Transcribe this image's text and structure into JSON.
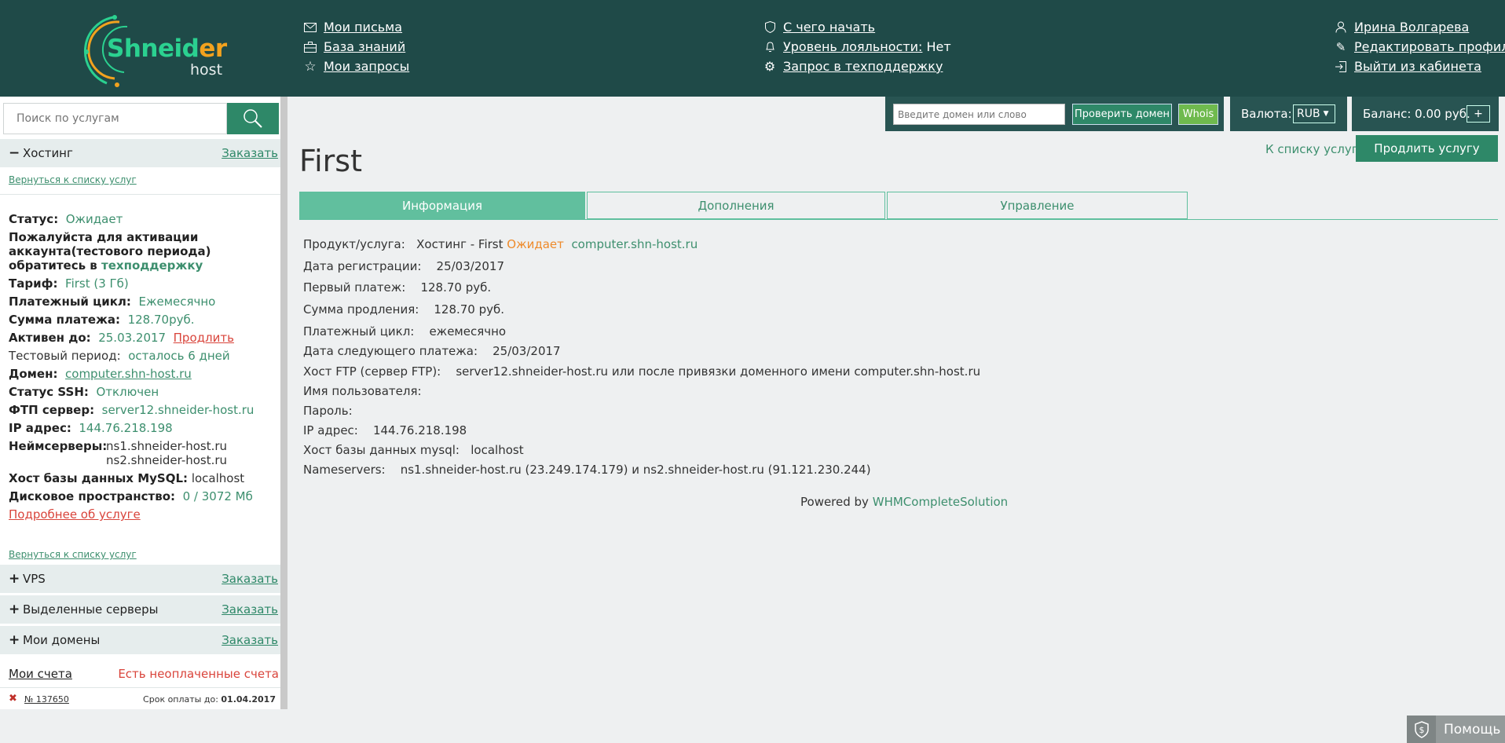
{
  "logo": {
    "word_part1": "Shneider",
    "word_part2": "host"
  },
  "header": {
    "nav_left": [
      {
        "label": "Мои письма",
        "icon": "mail-icon"
      },
      {
        "label": "База знаний",
        "icon": "briefcase-icon"
      },
      {
        "label": "Мои запросы",
        "icon": "star-icon"
      }
    ],
    "nav_mid": {
      "getting_started": "С чего начать",
      "loyalty_label": "Уровень лояльности:",
      "loyalty_value": "Нет",
      "support_request": "Запрос в техподдержку"
    },
    "user": {
      "name": "Ирина Волгарева",
      "edit_profile": "Редактировать профиль",
      "logout": "Выйти из кабинета"
    }
  },
  "sidebar": {
    "search_placeholder": "Поиск по услугам",
    "hosting": {
      "title": "Хостинг",
      "order": "Заказать",
      "back": "Вернуться к списку услуг"
    },
    "details": {
      "status_label": "Статус:",
      "status_value": "Ожидает",
      "warning_text": "Пожалуйста для активации аккаунта(тестового периода) обратитесь в",
      "warning_link": "техподдержку",
      "tariff_label": "Тариф:",
      "tariff_value": "First (3 Гб)",
      "cycle_label": "Платежный цикл:",
      "cycle_value": "Ежемесячно",
      "sum_label": "Сумма платежа:",
      "sum_value": "128.70руб.",
      "active_label": "Активен до:",
      "active_value": "25.03.2017",
      "renew_link": "Продлить",
      "trial_label": "Тестовый период:",
      "trial_value": "осталось 6 дней",
      "domain_label": "Домен:",
      "domain_value": "computer.shn-host.ru",
      "ssh_label": "Статус SSH:",
      "ssh_value": "Отключен",
      "ftp_label": "ФТП сервер:",
      "ftp_value": "server12.shneider-host.ru",
      "ip_label": "IP адрес:",
      "ip_value": "144.76.218.198",
      "ns_label": "Неймсерверы:",
      "ns1": "ns1.shneider-host.ru",
      "ns2": "ns2.shneider-host.ru",
      "mysql_label": "Хост базы данных MySQL:",
      "mysql_value": "localhost",
      "disk_label": "Дисковое пространство:",
      "disk_value": "0 / 3072 Мб",
      "more_link": "Подробнее об услуге"
    },
    "back_bottom": "Вернуться к списку услуг",
    "sections": [
      {
        "title": "VPS",
        "order": "Заказать"
      },
      {
        "title": "Выделенные серверы",
        "order": "Заказать"
      },
      {
        "title": "Мои домены",
        "order": "Заказать"
      }
    ],
    "invoices": {
      "title": "Мои счета",
      "warning": "Есть неоплаченные счета",
      "row": {
        "number": "№ 137650",
        "due_label": "Срок оплаты до:",
        "due_date": "01.04.2017"
      }
    }
  },
  "topbar": {
    "domain_placeholder": "Введите домен или слово",
    "check_button": "Проверить домен",
    "whois_button": "Whois",
    "currency_label": "Валюта:",
    "currency_value": "RUB",
    "balance": "Баланс: 0.00 руб.",
    "add_funds": "+"
  },
  "main": {
    "title": "First",
    "back_to_list": "К списку услуг",
    "renew_button": "Продлить услугу",
    "tabs": [
      "Информация",
      "Дополнения",
      "Управление"
    ],
    "info": {
      "product_label": "Продукт/услуга:",
      "product_value": "Хостинг - First",
      "product_status": "Ожидает",
      "product_domain": "computer.shn-host.ru",
      "reg_label": "Дата регистрации:",
      "reg_value": "25/03/2017",
      "first_label": "Первый платеж:",
      "first_value": "128.70 руб.",
      "renew_label": "Сумма продления:",
      "renew_value": "128.70 руб.",
      "cycle_label": "Платежный цикл:",
      "cycle_value": "ежемесячно",
      "next_label": "Дата следующего платежа:",
      "next_value": "25/03/2017",
      "ftp_label": "Хост FTP (сервер FTP):",
      "ftp_value": "server12.shneider-host.ru или после привязки доменного имени computer.shn-host.ru",
      "user_label": "Имя пользователя:",
      "pass_label": "Пароль:",
      "ip_label": "IP адрес:",
      "ip_value": "144.76.218.198",
      "db_label": "Хост базы данных mysql:",
      "db_value": "localhost",
      "ns_label": "Nameservers:",
      "ns_value": "ns1.shneider-host.ru (23.249.174.179) и ns2.shneider-host.ru (91.121.230.244)"
    },
    "powered_prefix": "Powered by",
    "powered_link": "WHMCompleteSolution"
  },
  "help_button": "Помощь",
  "colors": {
    "header": "#1f4a48",
    "accent": "#2e8868",
    "tab_active": "#61bf9e",
    "warning": "#d9443b",
    "pending": "#ee8a2a"
  }
}
